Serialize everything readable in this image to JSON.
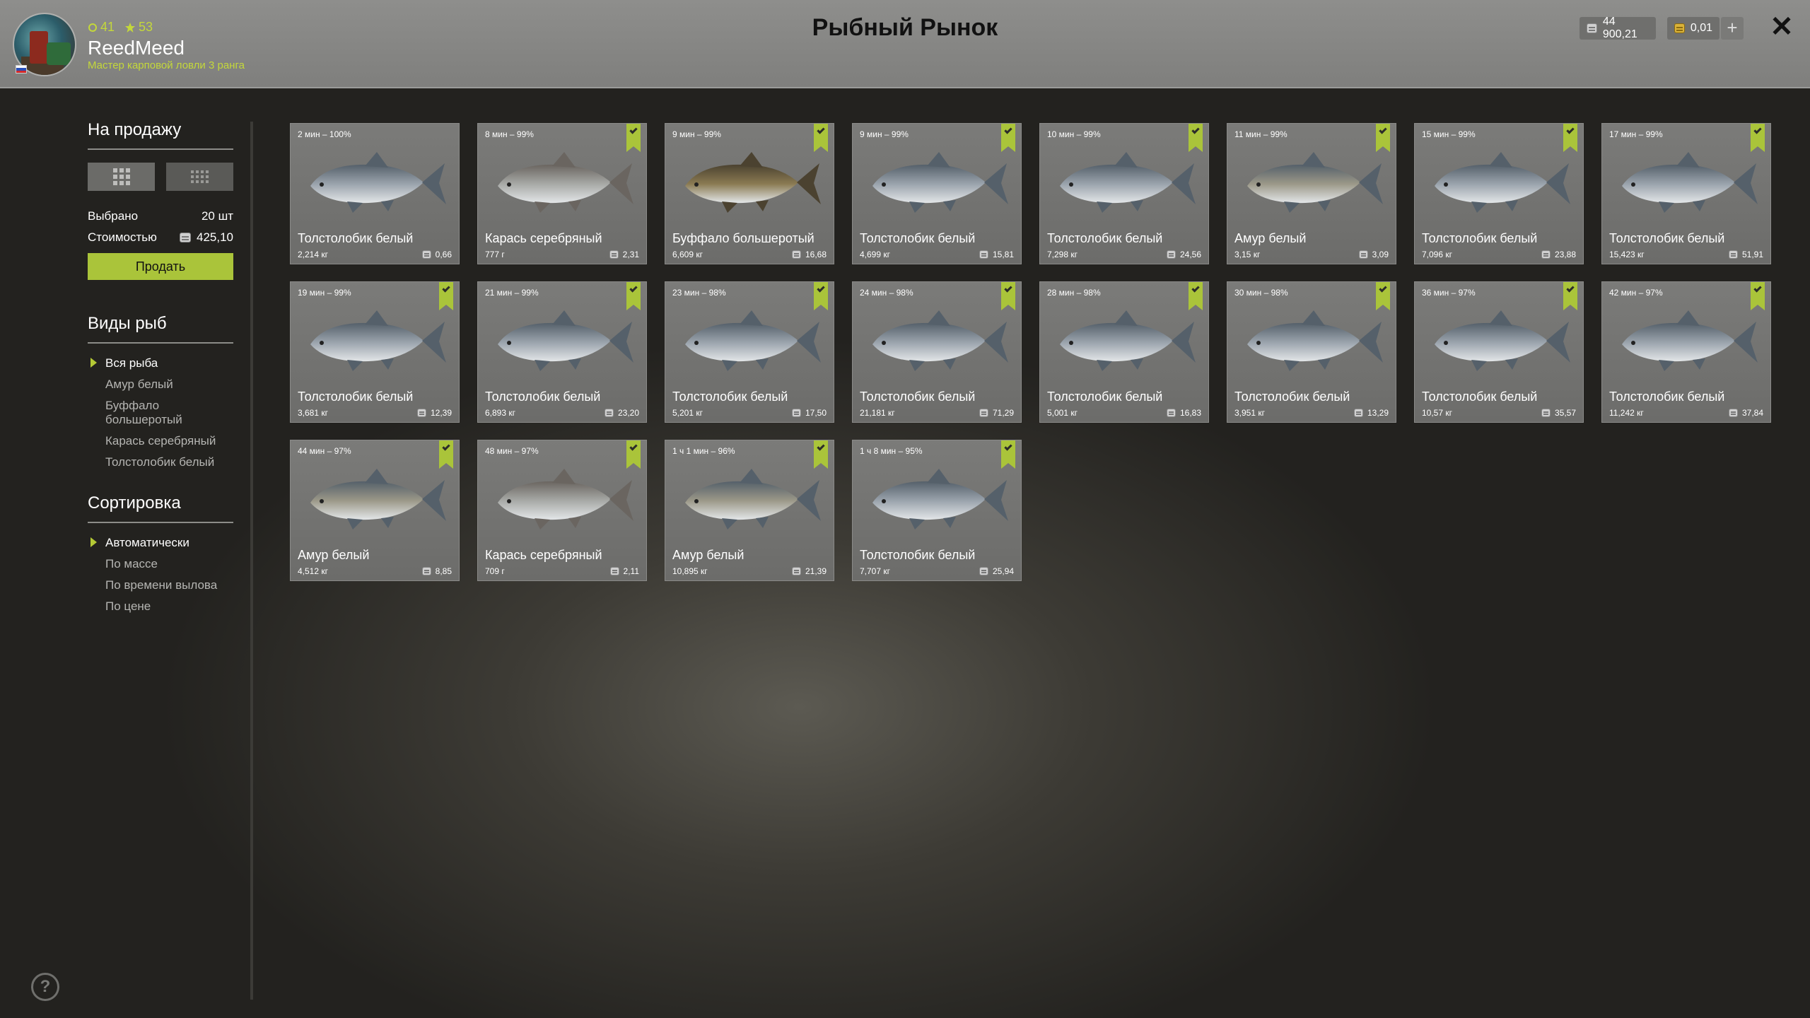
{
  "header": {
    "title": "Рыбный Рынок",
    "player": {
      "name": "ReedMeed",
      "rank_title": "Мастер карповой ловли 3 ранга",
      "level": "41",
      "stars": "53"
    },
    "currency": {
      "silver": "44 900,21",
      "gold": "0,01"
    },
    "add_label": "+",
    "close_label": "✕"
  },
  "sidebar": {
    "sale_title": "На продажу",
    "selected_label": "Выбрано",
    "selected_value": "20 шт",
    "cost_label": "Стоимостью",
    "cost_value": "425,10",
    "sell_button": "Продать",
    "species_title": "Виды рыб",
    "species": [
      "Вся рыба",
      "Амур белый",
      "Буффало большеротый",
      "Карась серебряный",
      "Толстолобик белый"
    ],
    "sort_title": "Сортировка",
    "sort": [
      "Автоматически",
      "По массе",
      "По времени вылова",
      "По цене"
    ]
  },
  "help_label": "?",
  "fish_colors": {
    "silver_carp": "#9aa3ac",
    "crucian": "#a7a9a6",
    "buffalo": "#8a7a52",
    "grass_carp": "#9b9888"
  },
  "accent_color": "#aac43a",
  "cards": [
    {
      "time": "2 мин – 100%",
      "name": "Толстолобик белый",
      "weight": "2,214 кг",
      "price": "0,66",
      "checked": false,
      "kind": "silver_carp"
    },
    {
      "time": "8 мин – 99%",
      "name": "Карась серебряный",
      "weight": "777 г",
      "price": "2,31",
      "checked": true,
      "kind": "crucian"
    },
    {
      "time": "9 мин – 99%",
      "name": "Буффало большеротый",
      "weight": "6,609 кг",
      "price": "16,68",
      "checked": true,
      "kind": "buffalo"
    },
    {
      "time": "9 мин – 99%",
      "name": "Толстолобик белый",
      "weight": "4,699 кг",
      "price": "15,81",
      "checked": true,
      "kind": "silver_carp"
    },
    {
      "time": "10 мин – 99%",
      "name": "Толстолобик белый",
      "weight": "7,298 кг",
      "price": "24,56",
      "checked": true,
      "kind": "silver_carp"
    },
    {
      "time": "11 мин – 99%",
      "name": "Амур белый",
      "weight": "3,15 кг",
      "price": "3,09",
      "checked": true,
      "kind": "grass_carp"
    },
    {
      "time": "15 мин – 99%",
      "name": "Толстолобик белый",
      "weight": "7,096 кг",
      "price": "23,88",
      "checked": true,
      "kind": "silver_carp"
    },
    {
      "time": "17 мин – 99%",
      "name": "Толстолобик белый",
      "weight": "15,423 кг",
      "price": "51,91",
      "checked": true,
      "kind": "silver_carp"
    },
    {
      "time": "19 мин – 99%",
      "name": "Толстолобик белый",
      "weight": "3,681 кг",
      "price": "12,39",
      "checked": true,
      "kind": "silver_carp"
    },
    {
      "time": "21 мин – 99%",
      "name": "Толстолобик белый",
      "weight": "6,893 кг",
      "price": "23,20",
      "checked": true,
      "kind": "silver_carp"
    },
    {
      "time": "23 мин – 98%",
      "name": "Толстолобик белый",
      "weight": "5,201 кг",
      "price": "17,50",
      "checked": true,
      "kind": "silver_carp"
    },
    {
      "time": "24 мин – 98%",
      "name": "Толстолобик белый",
      "weight": "21,181 кг",
      "price": "71,29",
      "checked": true,
      "kind": "silver_carp"
    },
    {
      "time": "28 мин – 98%",
      "name": "Толстолобик белый",
      "weight": "5,001 кг",
      "price": "16,83",
      "checked": true,
      "kind": "silver_carp"
    },
    {
      "time": "30 мин – 98%",
      "name": "Толстолобик белый",
      "weight": "3,951 кг",
      "price": "13,29",
      "checked": true,
      "kind": "silver_carp"
    },
    {
      "time": "36 мин – 97%",
      "name": "Толстолобик белый",
      "weight": "10,57 кг",
      "price": "35,57",
      "checked": true,
      "kind": "silver_carp"
    },
    {
      "time": "42 мин – 97%",
      "name": "Толстолобик белый",
      "weight": "11,242 кг",
      "price": "37,84",
      "checked": true,
      "kind": "silver_carp"
    },
    {
      "time": "44 мин – 97%",
      "name": "Амур белый",
      "weight": "4,512 кг",
      "price": "8,85",
      "checked": true,
      "kind": "grass_carp"
    },
    {
      "time": "48 мин – 97%",
      "name": "Карась серебряный",
      "weight": "709 г",
      "price": "2,11",
      "checked": true,
      "kind": "crucian"
    },
    {
      "time": "1 ч 1 мин – 96%",
      "name": "Амур белый",
      "weight": "10,895 кг",
      "price": "21,39",
      "checked": true,
      "kind": "grass_carp"
    },
    {
      "time": "1 ч 8 мин – 95%",
      "name": "Толстолобик белый",
      "weight": "7,707 кг",
      "price": "25,94",
      "checked": true,
      "kind": "silver_carp"
    }
  ]
}
